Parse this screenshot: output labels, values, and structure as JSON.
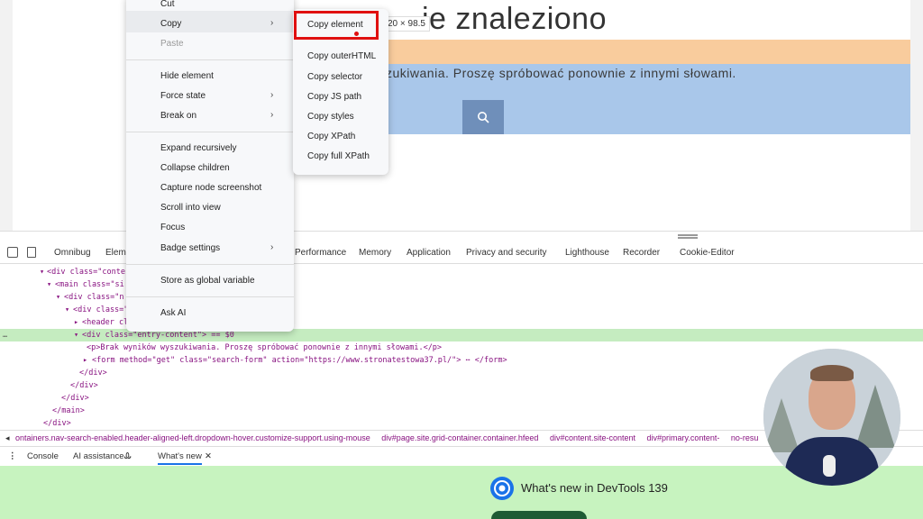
{
  "webpage": {
    "title_fragment": "ie znaleziono",
    "message_fragment": "zukiwania. Proszę spróbować ponownie z innymi słowami.",
    "element_size": "20 × 98.5"
  },
  "context_menu": {
    "items": [
      {
        "label": "Cut",
        "disabled": false
      },
      {
        "label": "Copy",
        "has_submenu": true
      },
      {
        "label": "Paste",
        "disabled": true
      },
      {
        "label": "Hide element"
      },
      {
        "label": "Force state",
        "has_submenu": true
      },
      {
        "label": "Break on",
        "has_submenu": true
      },
      {
        "label": "Expand recursively"
      },
      {
        "label": "Collapse children"
      },
      {
        "label": "Capture node screenshot"
      },
      {
        "label": "Scroll into view"
      },
      {
        "label": "Focus"
      },
      {
        "label": "Badge settings",
        "has_submenu": true
      },
      {
        "label": "Store as global variable"
      },
      {
        "label": "Ask AI"
      }
    ]
  },
  "copy_submenu": {
    "items": [
      "Copy element",
      "Copy outerHTML",
      "Copy selector",
      "Copy JS path",
      "Copy styles",
      "Copy XPath",
      "Copy full XPath"
    ],
    "highlighted": "Copy element"
  },
  "devtools_tabs": [
    "Omnibug",
    "Eleme",
    "Performance",
    "Memory",
    "Application",
    "Privacy and security",
    "Lighthouse",
    "Recorder",
    "Cookie-Editor"
  ],
  "elements_tree": [
    {
      "indent": 44,
      "arrow": "▾",
      "html": "<div class=\"conte"
    },
    {
      "indent": 52,
      "arrow": "▾",
      "html": "<main class=\"si"
    },
    {
      "indent": 62,
      "arrow": "▾",
      "html": "<div class=\"n"
    },
    {
      "indent": 72,
      "arrow": "▾",
      "html": "<div class=\""
    },
    {
      "indent": 82,
      "arrow": "▸",
      "html": "<header cl"
    },
    {
      "indent": 82,
      "arrow": "▾",
      "html": "<div class=\"entry-content\"> == $0",
      "selected": true
    },
    {
      "indent": 96,
      "arrow": "",
      "html": "<p>Brak wyników wyszukiwania. Proszę spróbować ponownie z innymi słowami.</p>"
    },
    {
      "indent": 92,
      "arrow": "▸",
      "html": "<form method=\"get\" class=\"search-form\" action=\"https://www.stronatestowa37.pl/\"> ⋯ </form>"
    },
    {
      "indent": 88,
      "arrow": "",
      "html": "</div>"
    },
    {
      "indent": 78,
      "arrow": "",
      "html": "</div>"
    },
    {
      "indent": 68,
      "arrow": "",
      "html": "</div>"
    },
    {
      "indent": 58,
      "arrow": "",
      "html": "</main>"
    },
    {
      "indent": 48,
      "arrow": "",
      "html": "</div>"
    }
  ],
  "breadcrumbs": [
    "ontainers.nav-search-enabled.header-aligned-left.dropdown-hover.customize-support.using-mouse",
    "div#page.site.grid-container.container.hfeed",
    "div#content.site-content",
    "div#primary.content-",
    "no-resu"
  ],
  "drawer_tabs": {
    "console": "Console",
    "ai_assistance": "AI assistance",
    "whats_new": "What's new"
  },
  "whats_new_title": "What's new in DevTools 139",
  "selected_marker": "…",
  "colors": {
    "highlight_red": "#e01010",
    "selection_green": "#c5ecc0",
    "drawer_green": "#c7f3bf"
  }
}
